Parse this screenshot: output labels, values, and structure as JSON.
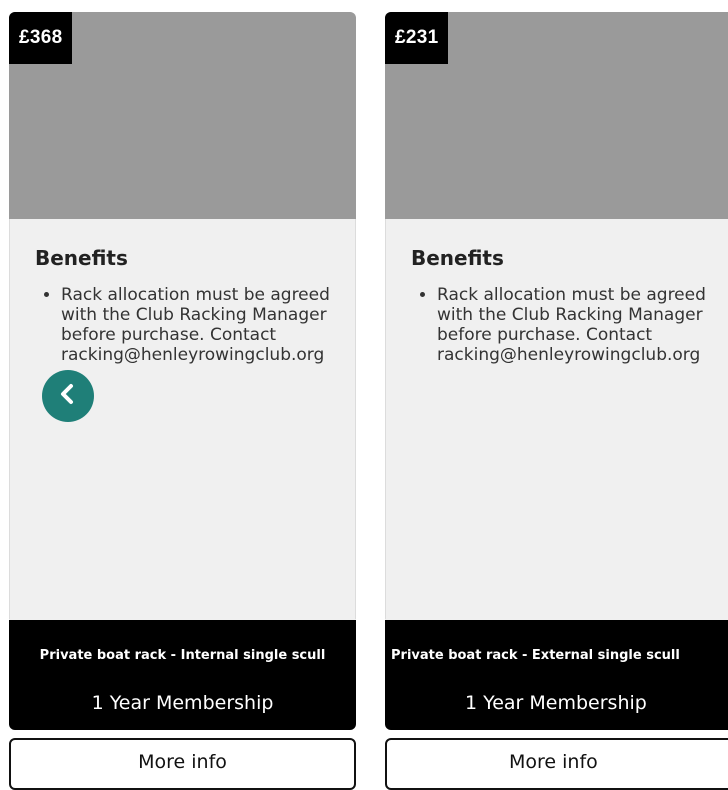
{
  "cards": [
    {
      "price": "£368",
      "benefits_heading": "Benefits",
      "benefits": [
        "Rack allocation must be agreed with the Club Racking Manager before purchase. Contact racking@henleyrowingclub.org"
      ],
      "product_name": "Private boat rack - Internal single scull",
      "membership": "1 Year Membership",
      "more_info_label": "More info"
    },
    {
      "price": "£231",
      "benefits_heading": "Benefits",
      "benefits": [
        "Rack allocation must be agreed with the Club Racking Manager before purchase. Contact racking@henleyrowingclub.org"
      ],
      "product_name": "Private boat rack - External single scull",
      "membership": "1 Year Membership",
      "more_info_label": "More info"
    }
  ],
  "colors": {
    "image_placeholder": "#9a9a9a",
    "card_body": "#f0f0f0",
    "footer": "#000000",
    "fab": "#1f7f78"
  },
  "icons": {
    "fab": "chevron-left-icon"
  }
}
